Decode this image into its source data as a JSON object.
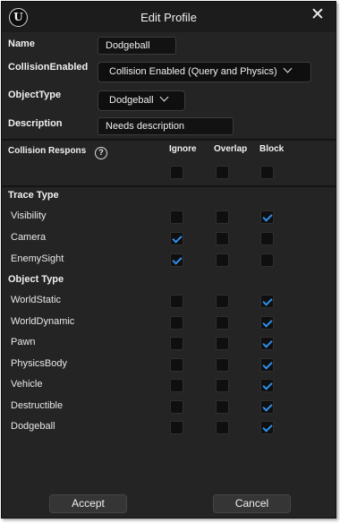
{
  "window": {
    "title": "Edit Profile",
    "logo_icon": "unreal-logo-icon",
    "close_glyph": "✕"
  },
  "fields": {
    "name_label": "Name",
    "name_value": "Dodgeball",
    "collision_label": "CollisionEnabled",
    "collision_value": "Collision Enabled (Query and Physics)",
    "objecttype_label": "ObjectType",
    "objecttype_value": "Dodgeball",
    "description_label": "Description",
    "description_value": "Needs description"
  },
  "responses": {
    "label": "Collision Respons",
    "help_icon": "?",
    "columns": [
      "Ignore",
      "Overlap",
      "Block"
    ],
    "master": [
      false,
      false,
      false
    ]
  },
  "trace_type": {
    "heading": "Trace Type",
    "rows": [
      {
        "name": "Visibility",
        "checks": [
          false,
          false,
          true
        ]
      },
      {
        "name": "Camera",
        "checks": [
          true,
          false,
          false
        ]
      },
      {
        "name": "EnemySight",
        "checks": [
          true,
          false,
          false
        ]
      }
    ]
  },
  "object_type": {
    "heading": "Object Type",
    "rows": [
      {
        "name": "WorldStatic",
        "checks": [
          false,
          false,
          true
        ]
      },
      {
        "name": "WorldDynamic",
        "checks": [
          false,
          false,
          true
        ]
      },
      {
        "name": "Pawn",
        "checks": [
          false,
          false,
          true
        ]
      },
      {
        "name": "PhysicsBody",
        "checks": [
          false,
          false,
          true
        ]
      },
      {
        "name": "Vehicle",
        "checks": [
          false,
          false,
          true
        ]
      },
      {
        "name": "Destructible",
        "checks": [
          false,
          false,
          true
        ]
      },
      {
        "name": "Dodgeball",
        "checks": [
          false,
          false,
          true
        ]
      }
    ]
  },
  "buttons": {
    "accept": "Accept",
    "cancel": "Cancel"
  },
  "colors": {
    "check_accent": "#2f8fea",
    "window_bg": "#242424",
    "titlebar_bg": "#1c1c1c"
  }
}
